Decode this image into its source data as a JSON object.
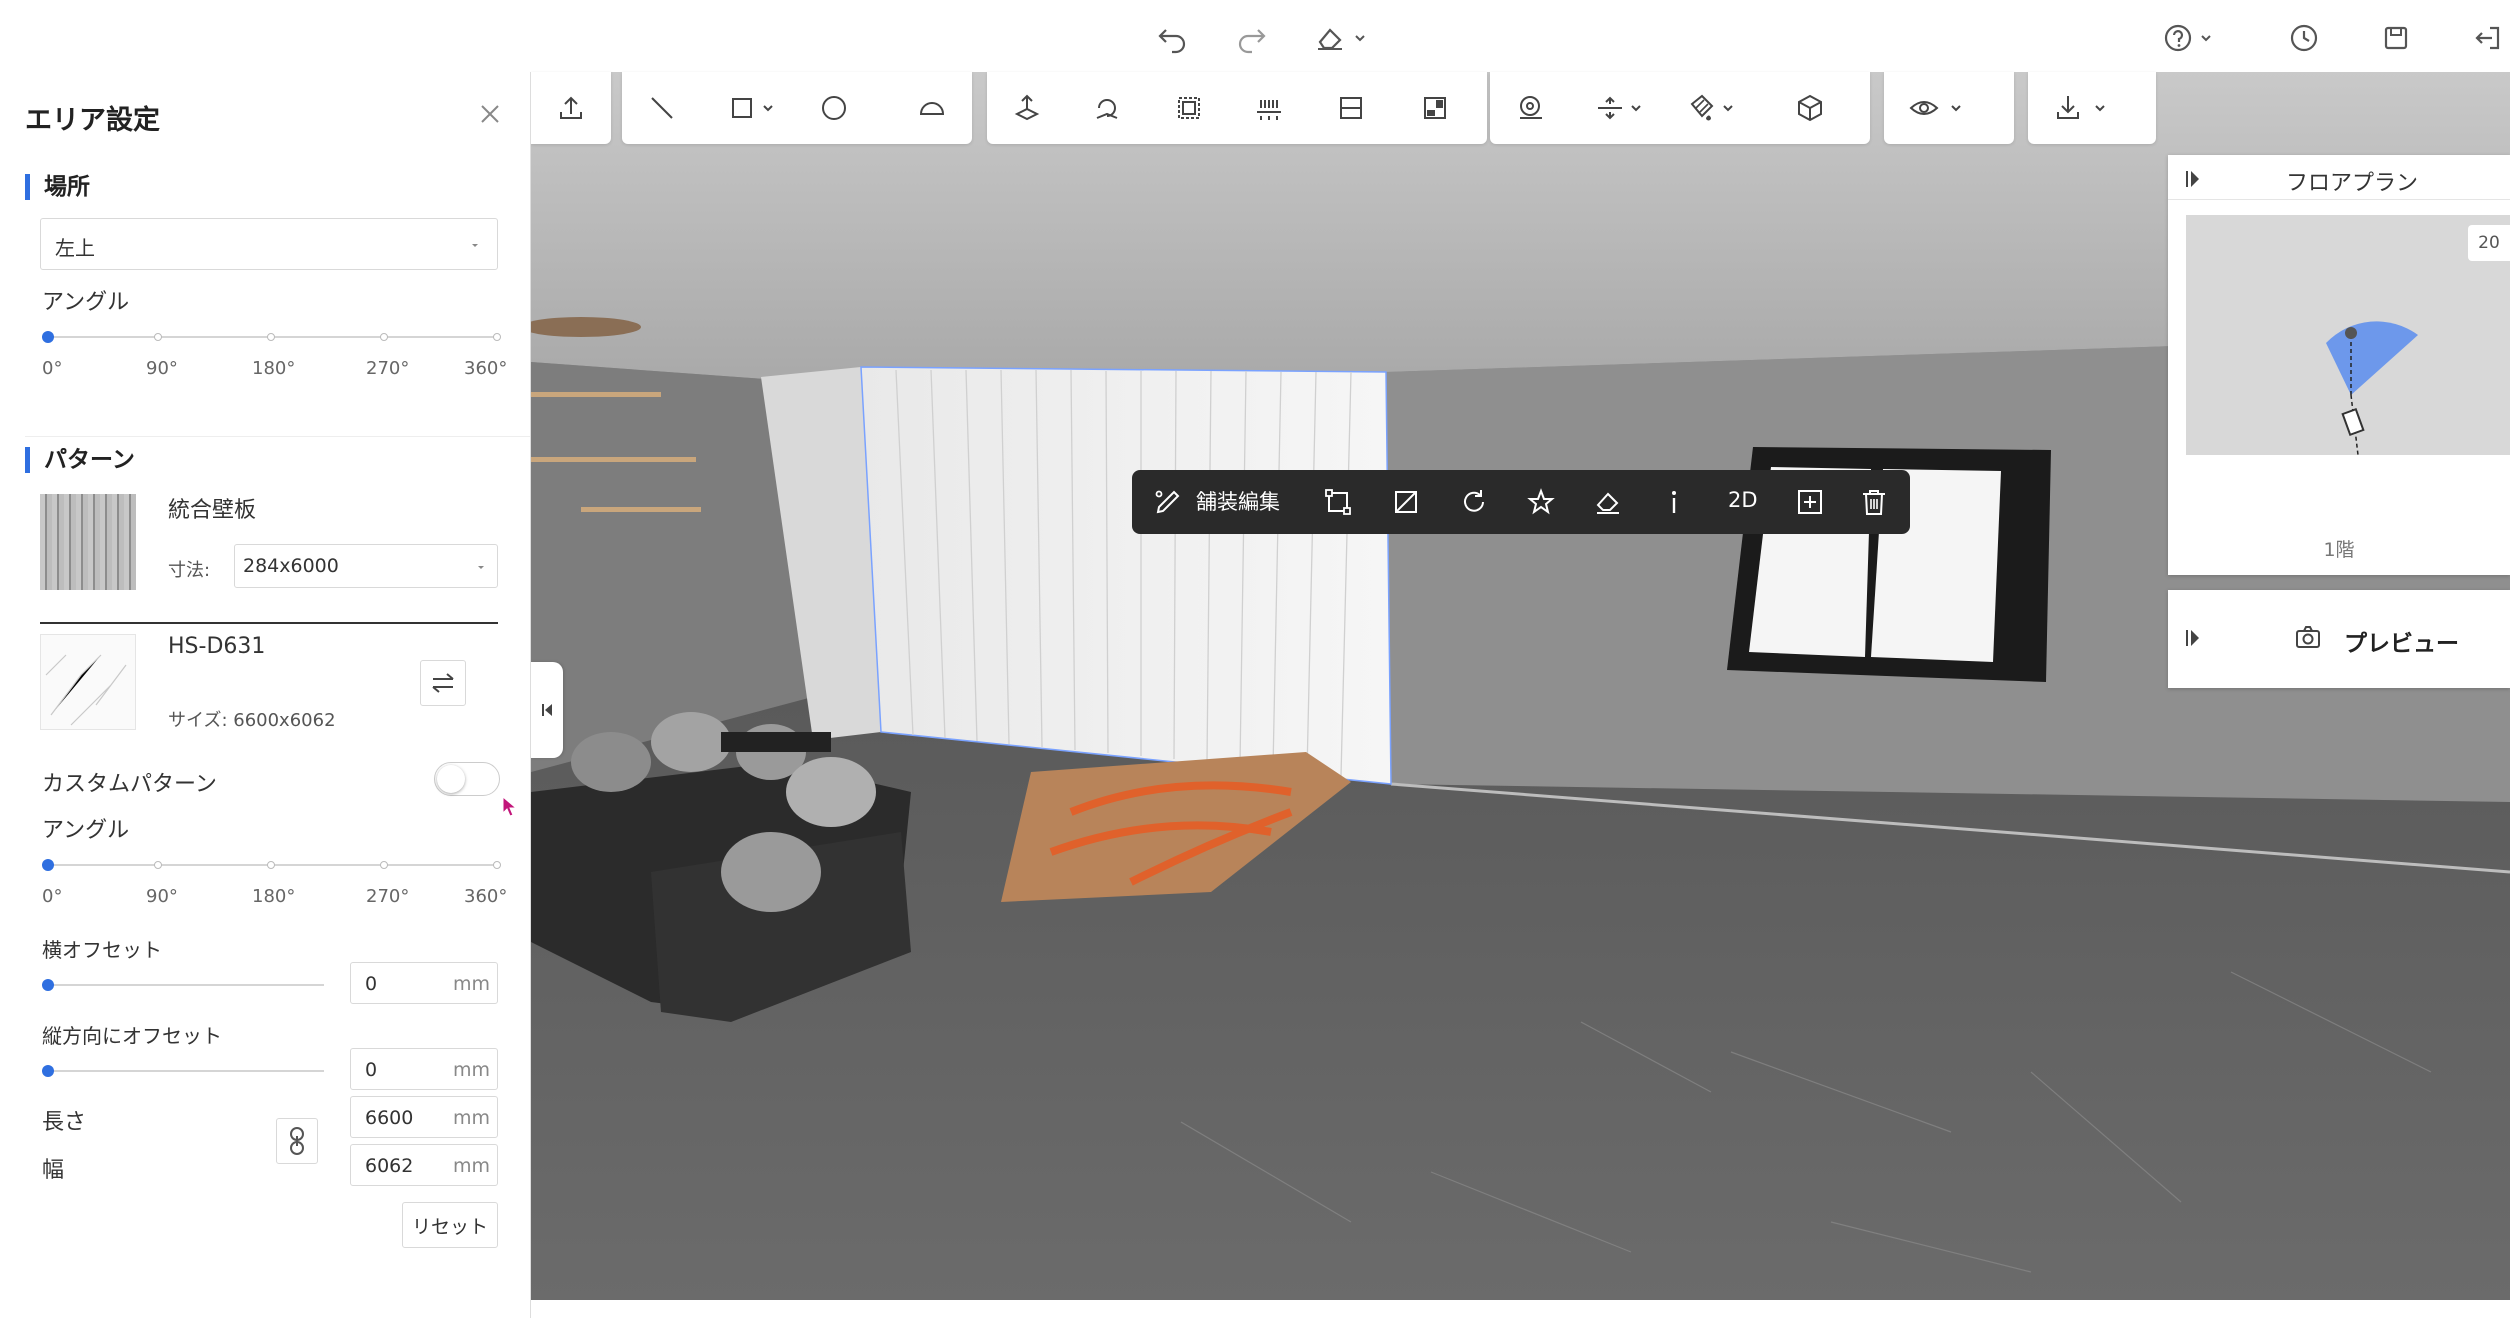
{
  "panel": {
    "title": "エリア設定",
    "location_section": "場所",
    "location_value": "左上",
    "angle_label": "アングル",
    "angle_ticks": [
      "0°",
      "90°",
      "180°",
      "270°",
      "360°"
    ],
    "pattern_section": "パターン",
    "pattern_name": "統合壁板",
    "size_label": "寸法:",
    "size_value": "284x6000",
    "material_code": "HS-D631",
    "material_size": "サイズ: 6600x6062",
    "custom_pattern_label": "カスタムパターン",
    "custom_pattern_on": false,
    "pattern_angle_label": "アングル",
    "h_offset_label": "横オフセット",
    "h_offset_value": "0",
    "v_offset_label": "縦方向にオフセット",
    "v_offset_value": "0",
    "unit": "mm",
    "length_label": "長さ",
    "length_value": "6600",
    "width_label": "幅",
    "width_value": "6062",
    "reset_label": "リセット"
  },
  "context_toolbar": {
    "edit_label": "舗装編集",
    "view_2d": "2D"
  },
  "floorplan": {
    "title": "フロアプラン",
    "floor_label": "1階",
    "badge": "20"
  },
  "preview": {
    "title": "プレビュー"
  },
  "colors": {
    "accent": "#2f6fe0",
    "toolbar_dark": "#2a2a2a",
    "camera_cone": "#5b8def"
  }
}
